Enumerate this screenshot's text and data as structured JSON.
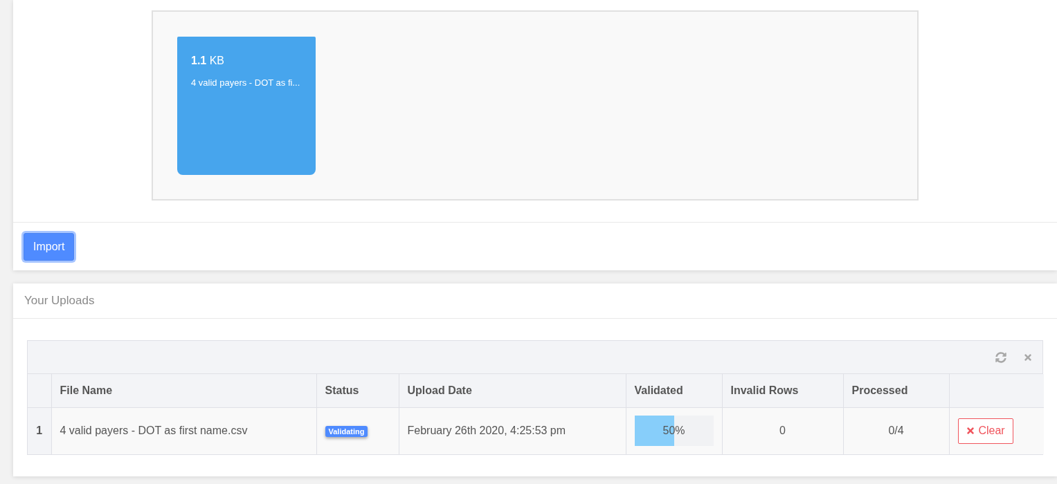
{
  "dropzone": {
    "file_preview": {
      "size": "**1.1** KB",
      "file_name": "4 valid payers - DOT as fi..."
    }
  },
  "import_button": {
    "label": "Import",
    "focused": true
  },
  "uploads": {
    "title": "Your Uploads",
    "table": {
      "columns": [
        "File Name",
        "Status",
        "Upload Date",
        "Validated",
        "Invalid Rows",
        "Processed"
      ],
      "rows": [
        {
          "index": "1",
          "file_name": "4 valid payers - DOT as first name.csv",
          "status": "Validating",
          "upload_date": "February 26th 2020, 4:25:53 pm",
          "validated": {
            "level": 0.5,
            "reading": "50%"
          },
          "invalid_rows": "0",
          "processed": "0/4",
          "action": "Clear"
        }
      ]
    }
  }
}
